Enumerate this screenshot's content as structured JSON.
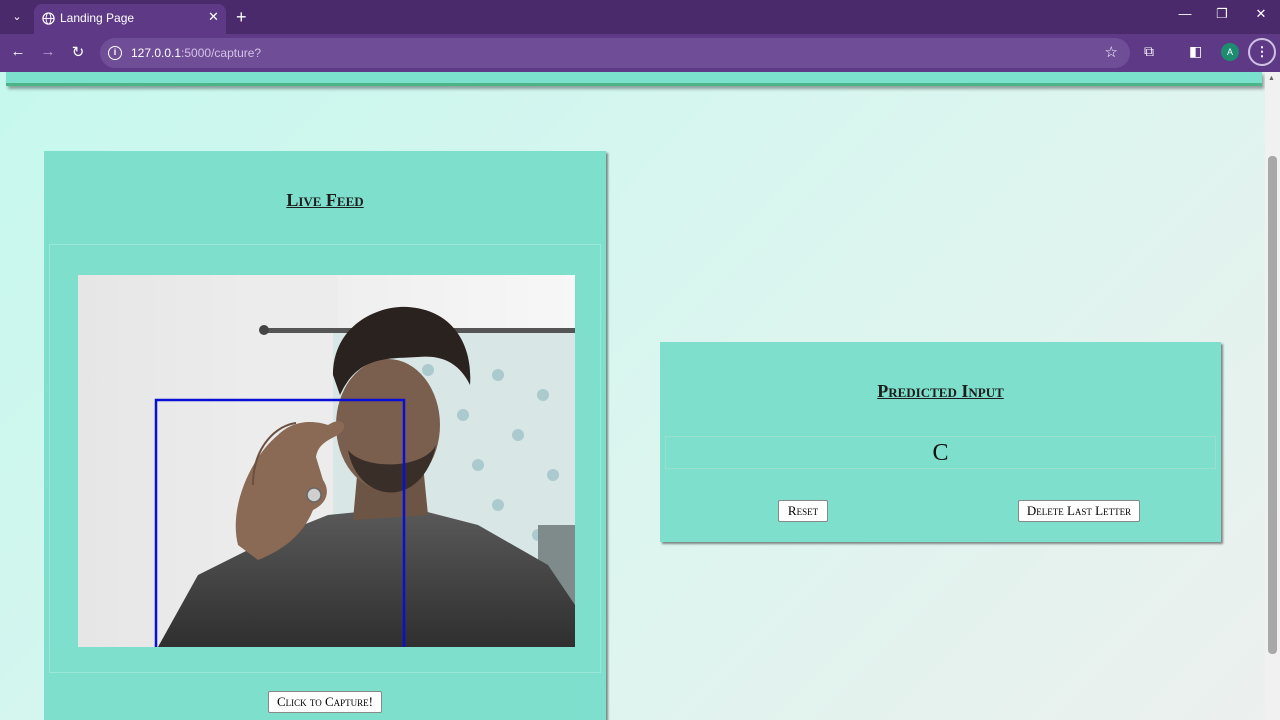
{
  "browser": {
    "tab_title": "Landing Page",
    "tab_close": "✕",
    "new_tab": "+",
    "url_host": "127.0.0.1",
    "url_rest": ":5000/capture?",
    "profile_initial": "A",
    "theme_color": "#5e3a86"
  },
  "icons": {
    "back": "←",
    "forward": "→",
    "reload": "↻",
    "star": "☆",
    "extensions": "⧉",
    "sidepanel": "◧",
    "menu": "⋮",
    "minimize": "—",
    "restore": "❐",
    "close": "✕",
    "tab_search": "⌄"
  },
  "live_feed": {
    "title": "Live Feed",
    "capture_button": "Click to Capture!"
  },
  "predicted": {
    "title": "Predicted Input",
    "output": "C",
    "reset_button": "Reset",
    "delete_button": "Delete Last Letter"
  },
  "colors": {
    "card": "#7ddfcc",
    "background": "#c6f8ee",
    "detection_box": "#0a0fd6"
  }
}
